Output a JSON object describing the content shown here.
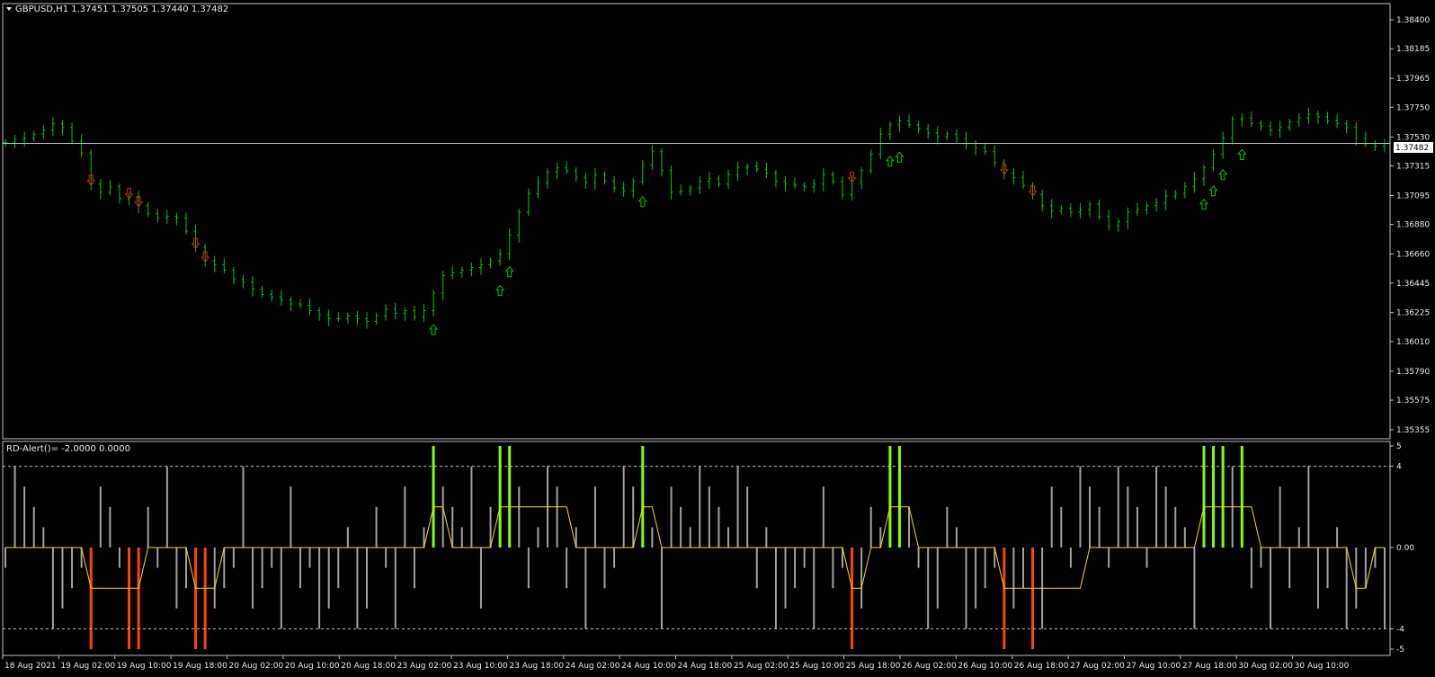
{
  "main_panel": {
    "symbol_line": "GBPUSD,H1  1.37451 1.37505 1.37440 1.37482",
    "current_price_tag": "1.37482",
    "price_labels": [
      "1.38400",
      "1.38185",
      "1.37965",
      "1.37750",
      "1.37530",
      "1.37315",
      "1.37095",
      "1.36880",
      "1.36660",
      "1.36445",
      "1.36225",
      "1.36010",
      "1.35790",
      "1.35575",
      "1.35355"
    ],
    "bar_color": "#00c800",
    "up_arrow_color": "#00c800",
    "down_arrow_color": "#e02020",
    "price_line_color": "#b0c4c4"
  },
  "sub_panel": {
    "indicator_line": "RD-Alert()= -2.0000 0.0000",
    "level_labels": [
      "5",
      "4",
      "0.00",
      "-4",
      "-5"
    ],
    "neutral_bar_color": "#a0a0a0",
    "buy_bar_color": "#7fff00",
    "sell_bar_color": "#ff4500",
    "signal_line_color": "#ffd700"
  },
  "time_labels": [
    "18 Aug 2021",
    "19 Aug 02:00",
    "19 Aug 10:00",
    "19 Aug 18:00",
    "20 Aug 02:00",
    "20 Aug 10:00",
    "20 Aug 18:00",
    "23 Aug 02:00",
    "23 Aug 10:00",
    "23 Aug 18:00",
    "24 Aug 02:00",
    "24 Aug 10:00",
    "24 Aug 18:00",
    "25 Aug 02:00",
    "25 Aug 10:00",
    "25 Aug 18:00",
    "26 Aug 02:00",
    "26 Aug 10:00",
    "26 Aug 18:00",
    "27 Aug 02:00",
    "27 Aug 10:00",
    "27 Aug 18:00",
    "30 Aug 02:00",
    "30 Aug 10:00"
  ],
  "chart_data": {
    "type": "line",
    "title": "GBPUSD,H1",
    "series": [
      {
        "name": "GBPUSD,H1",
        "values": [
          1.3749,
          1.3751,
          1.3752,
          1.3755,
          1.3758,
          1.3763,
          1.376,
          1.375,
          1.3741,
          1.3718,
          1.3712,
          1.3716,
          1.3707,
          1.3708,
          1.3702,
          1.3696,
          1.3693,
          1.3694,
          1.3693,
          1.3683,
          1.3671,
          1.3661,
          1.3658,
          1.3654,
          1.3647,
          1.3645,
          1.364,
          1.3636,
          1.3634,
          1.3632,
          1.3629,
          1.3628,
          1.3624,
          1.3621,
          1.3618,
          1.3618,
          1.362,
          1.3618,
          1.3616,
          1.362,
          1.3625,
          1.3622,
          1.3624,
          1.3619,
          1.3624,
          1.3637,
          1.365,
          1.3652,
          1.3654,
          1.3656,
          1.3658,
          1.3661,
          1.3666,
          1.368,
          1.3697,
          1.3711,
          1.3719,
          1.3727,
          1.373,
          1.3728,
          1.3723,
          1.3719,
          1.3725,
          1.372,
          1.3715,
          1.3713,
          1.372,
          1.3732,
          1.3742,
          1.3728,
          1.3712,
          1.3713,
          1.3715,
          1.372,
          1.3722,
          1.3718,
          1.3725,
          1.373,
          1.3731,
          1.3729,
          1.3726,
          1.372,
          1.3718,
          1.3717,
          1.3716,
          1.3718,
          1.3725,
          1.372,
          1.371,
          1.372,
          1.3728,
          1.374,
          1.3755,
          1.3762,
          1.3765,
          1.3762,
          1.3759,
          1.3756,
          1.3753,
          1.3755,
          1.3752,
          1.3748,
          1.3745,
          1.3742,
          1.3734,
          1.3726,
          1.3723,
          1.3717,
          1.371,
          1.3702,
          1.3698,
          1.37,
          1.3697,
          1.3699,
          1.3703,
          1.3694,
          1.3687,
          1.369,
          1.3697,
          1.3699,
          1.3702,
          1.3704,
          1.3709,
          1.3711,
          1.3716,
          1.3722,
          1.373,
          1.374,
          1.3752,
          1.3766,
          1.3767,
          1.3763,
          1.3761,
          1.3758,
          1.376,
          1.3764,
          1.3767,
          1.377,
          1.3768,
          1.3765,
          1.3763,
          1.376,
          1.3752,
          1.3748,
          1.3746,
          1.3748
        ]
      },
      {
        "name": "RD-Alert()",
        "values": [
          0,
          0,
          0,
          0,
          0,
          0,
          0,
          0,
          0,
          -2,
          -2,
          -2,
          -2,
          -2,
          -2,
          0,
          0,
          0,
          0,
          0,
          -2,
          -2,
          -2,
          0,
          0,
          0,
          0,
          0,
          0,
          0,
          0,
          0,
          0,
          0,
          0,
          0,
          0,
          0,
          0,
          0,
          0,
          0,
          0,
          0,
          0,
          2,
          2,
          0,
          0,
          0,
          0,
          0,
          2,
          2,
          2,
          2,
          2,
          2,
          2,
          2,
          0,
          0,
          0,
          0,
          0,
          0,
          0,
          2,
          2,
          0,
          0,
          0,
          0,
          0,
          0,
          0,
          0,
          0,
          0,
          0,
          0,
          0,
          0,
          0,
          0,
          0,
          0,
          0,
          0,
          -2,
          -2,
          0,
          0,
          2,
          2,
          2,
          0,
          0,
          0,
          0,
          0,
          0,
          0,
          0,
          0,
          -2,
          -2,
          -2,
          -2,
          -2,
          -2,
          -2,
          -2,
          -2,
          0,
          0,
          0,
          0,
          0,
          0,
          0,
          0,
          0,
          0,
          0,
          0,
          2,
          2,
          2,
          2,
          2,
          2,
          0,
          0,
          0,
          0,
          0,
          0,
          0,
          0,
          0,
          0,
          -2,
          -2,
          0,
          0
        ]
      }
    ],
    "markers": {
      "buy_bars_index": [
        45,
        52,
        53,
        67,
        93,
        94,
        126,
        127,
        128,
        130
      ],
      "sell_bars_index": [
        9,
        13,
        14,
        20,
        21,
        89,
        105,
        108
      ]
    },
    "ylim_price": [
      1.35355,
      1.384
    ],
    "ylim_indicator": [
      -5,
      5
    ],
    "grid": false
  }
}
